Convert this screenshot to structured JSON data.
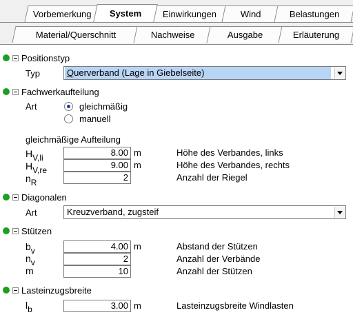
{
  "tabs_row1": [
    {
      "label": "Vorbemerkung",
      "active": false
    },
    {
      "label": "System",
      "active": true
    },
    {
      "label": "Einwirkungen",
      "active": false
    },
    {
      "label": "Wind",
      "active": false
    },
    {
      "label": "Belastungen",
      "active": false
    }
  ],
  "tabs_row2": [
    {
      "label": "Material/Querschnitt"
    },
    {
      "label": "Nachweise"
    },
    {
      "label": "Ausgabe"
    },
    {
      "label": "Erläuterung"
    }
  ],
  "sections": {
    "positionstyp": {
      "title": "Positionstyp",
      "typ_label": "Typ",
      "typ_value_underlined": "Q",
      "typ_value_rest": "uerverband (Lage in Giebelseite)"
    },
    "fachwerk": {
      "title": "Fachwerkaufteilung",
      "art_label": "Art",
      "radio_options": [
        "gleichmäßig",
        "manuell"
      ],
      "selected": "gleichmäßig",
      "sub_title": "gleichmäßige Aufteilung",
      "rows": [
        {
          "sym": "H",
          "sub": "V,li",
          "value": "8.00",
          "unit": "m",
          "desc": "Höhe des Verbandes, links"
        },
        {
          "sym": "H",
          "sub": "V,re",
          "value": "9.00",
          "unit": "m",
          "desc": "Höhe des Verbandes, rechts"
        },
        {
          "sym": "n",
          "sub": "R",
          "value": "2",
          "unit": "",
          "desc": "Anzahl der Riegel"
        }
      ]
    },
    "diagonalen": {
      "title": "Diagonalen",
      "art_label": "Art",
      "art_value": "Kreuzverband, zugsteif"
    },
    "stuetzen": {
      "title": "Stützen",
      "rows": [
        {
          "sym": "b",
          "sub": "v",
          "value": "4.00",
          "unit": "m",
          "desc": "Abstand der Stützen"
        },
        {
          "sym": "n",
          "sub": "v",
          "value": "2",
          "unit": "",
          "desc": "Anzahl der Verbände"
        },
        {
          "sym": "m",
          "sub": "",
          "value": "10",
          "unit": "",
          "desc": "Anzahl der Stützen"
        }
      ]
    },
    "lasteinzug": {
      "title": "Lasteinzugsbreite",
      "rows": [
        {
          "sym": "l",
          "sub": "b",
          "value": "3.00",
          "unit": "m",
          "desc": "Lasteinzugsbreite Windlasten"
        }
      ]
    }
  },
  "colors": {
    "status_dot": "#1f9e1f",
    "selection": "#b9d5f5",
    "radio_dot": "#1a3f8f"
  }
}
